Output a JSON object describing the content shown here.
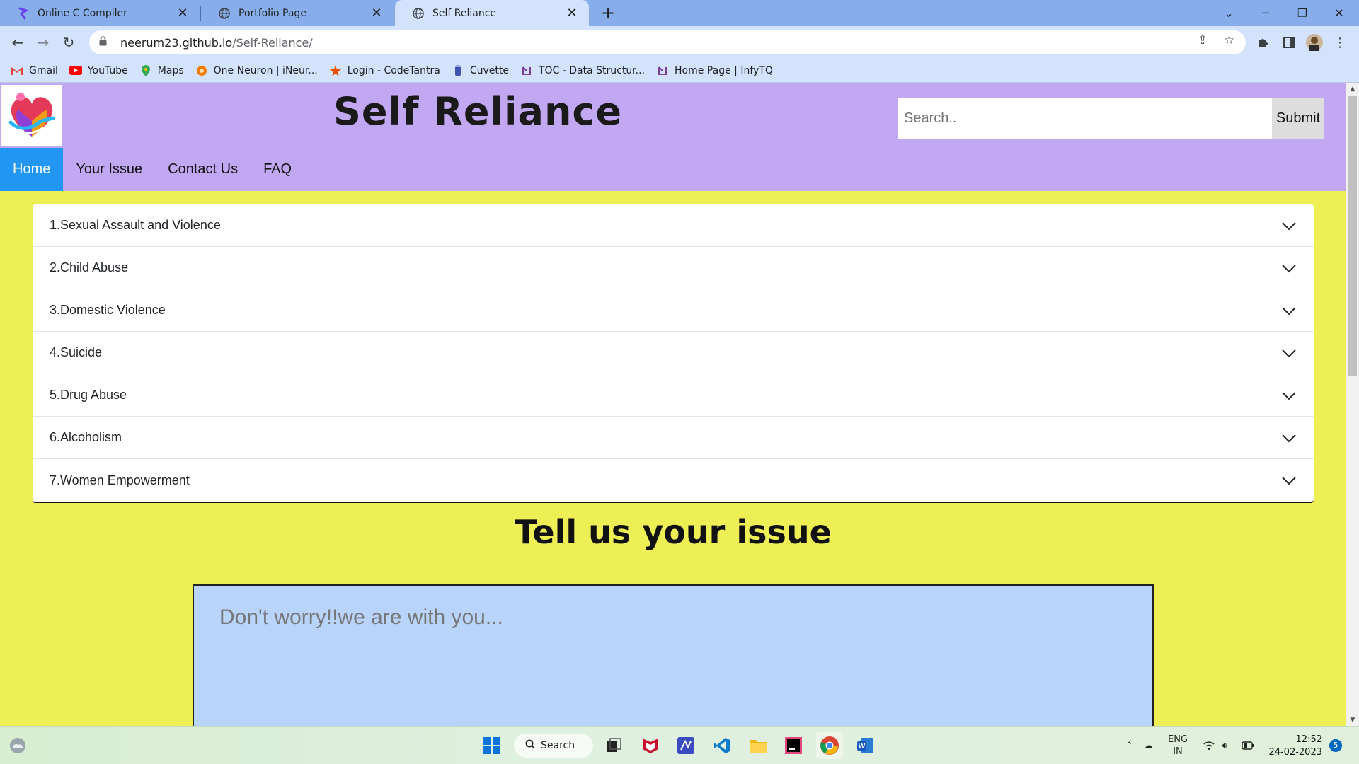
{
  "browser": {
    "tabs": [
      {
        "title": "Online C Compiler",
        "icon": "programiz-icon"
      },
      {
        "title": "Portfolio Page",
        "icon": "globe-icon"
      },
      {
        "title": "Self Reliance",
        "icon": "globe-icon",
        "active": true
      }
    ],
    "url_host": "neerum23.github.io",
    "url_path": "/Self-Reliance/",
    "bookmarks": [
      {
        "label": "Gmail",
        "icon": "gmail-icon",
        "color": "#ea4335"
      },
      {
        "label": "YouTube",
        "icon": "youtube-icon",
        "color": "#ff0000"
      },
      {
        "label": "Maps",
        "icon": "maps-icon",
        "color": "#34a853"
      },
      {
        "label": "One Neuron | iNeur...",
        "icon": "ineuron-icon",
        "color": "#f57c00"
      },
      {
        "label": "Login - CodeTantra",
        "icon": "codetantra-icon",
        "color": "#e65100"
      },
      {
        "label": "Cuvette",
        "icon": "cuvette-icon",
        "color": "#3f51b5"
      },
      {
        "label": "TOC - Data Structur...",
        "icon": "infytq-icon",
        "color": "#7b3fa0"
      },
      {
        "label": "Home Page | InfyTQ",
        "icon": "infytq-icon",
        "color": "#7b3fa0"
      }
    ]
  },
  "site": {
    "title": "Self Reliance",
    "search_placeholder": "Search..",
    "submit_label": "Submit",
    "nav": [
      {
        "label": "Home",
        "active": true
      },
      {
        "label": "Your Issue"
      },
      {
        "label": "Contact Us"
      },
      {
        "label": "FAQ"
      }
    ],
    "topics": [
      "1.Sexual Assault and Violence",
      "2.Child Abuse",
      "3.Domestic Violence",
      "4.Suicide",
      "5.Drug Abuse",
      "6.Alcoholism",
      "7.Women Empowerment"
    ],
    "issue_heading": "Tell us your issue",
    "issue_placeholder": "Don't worry!!we are with you..."
  },
  "taskbar": {
    "search_label": "Search",
    "language_line1": "ENG",
    "language_line2": "IN",
    "time": "12:52",
    "date": "24-02-2023",
    "notification_count": "5"
  },
  "colors": {
    "page_bg": "#eeee55",
    "header_bg": "#c2a7f2",
    "nav_active": "#2196f3",
    "textarea_bg": "#b8d4fb"
  }
}
